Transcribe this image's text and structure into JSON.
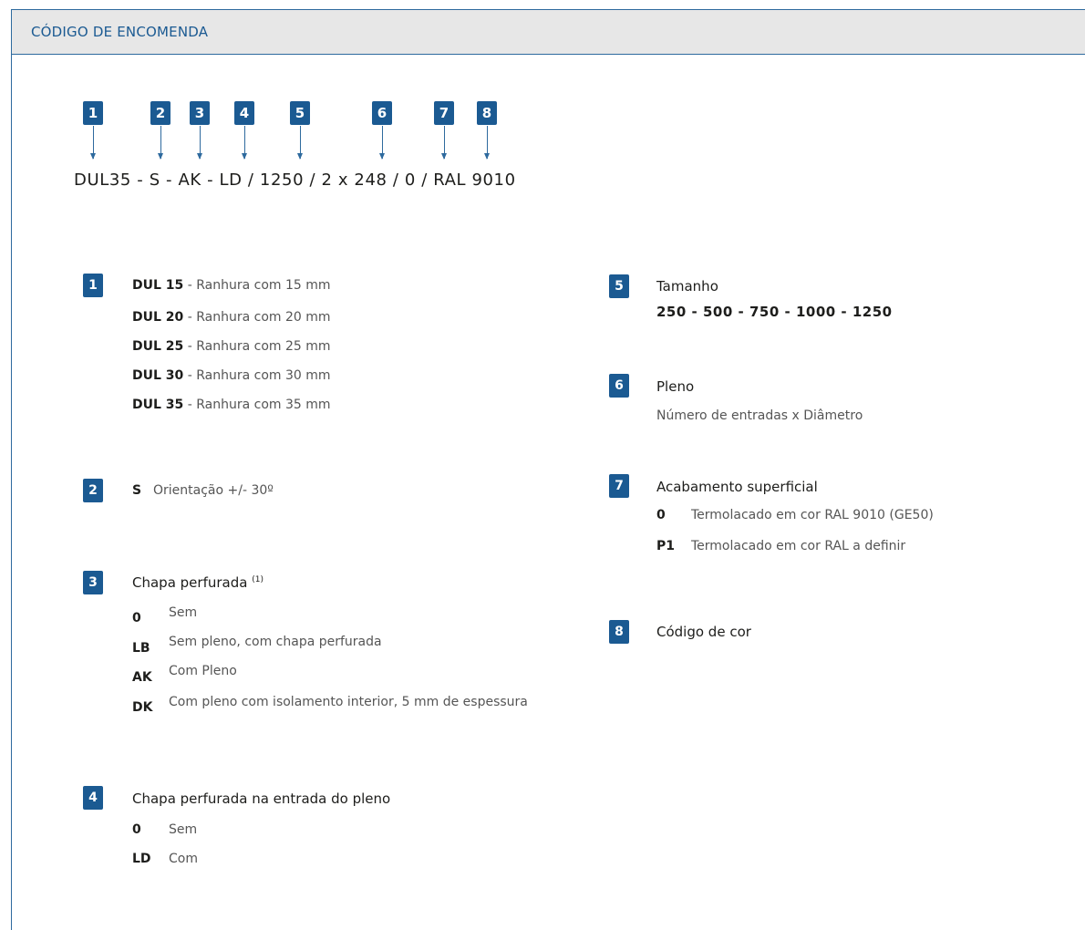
{
  "header": {
    "title": "CÓDIGO DE ENCOMENDA"
  },
  "code": {
    "badges": [
      "1",
      "2",
      "3",
      "4",
      "5",
      "6",
      "7",
      "8"
    ],
    "text": "DUL35 - S - AK - LD / 1250 / 2 x 248 / 0 / RAL 9010"
  },
  "sections": {
    "s1": {
      "num": "1",
      "items": [
        {
          "code": "DUL 15",
          "desc": " - Ranhura com 15 mm"
        },
        {
          "code": "DUL 20",
          "desc": " - Ranhura com 20 mm"
        },
        {
          "code": "DUL 25",
          "desc": " - Ranhura com 25 mm"
        },
        {
          "code": "DUL 30",
          "desc": " - Ranhura com 30 mm"
        },
        {
          "code": "DUL 35",
          "desc": " - Ranhura com 35 mm"
        }
      ]
    },
    "s2": {
      "num": "2",
      "code": "S",
      "desc": "Orientação +/- 30º"
    },
    "s3": {
      "num": "3",
      "title": "Chapa perfurada",
      "note": "(1)",
      "items": [
        {
          "code": "0",
          "desc": "Sem"
        },
        {
          "code": "LB",
          "desc": "Sem pleno, com chapa perfurada"
        },
        {
          "code": "AK",
          "desc": "Com Pleno"
        },
        {
          "code": "DK",
          "desc": "Com pleno com isolamento interior, 5 mm de espessura"
        }
      ]
    },
    "s4": {
      "num": "4",
      "title": "Chapa perfurada na entrada do pleno",
      "items": [
        {
          "code": "0",
          "desc": "Sem"
        },
        {
          "code": "LD",
          "desc": "Com"
        }
      ]
    },
    "s5": {
      "num": "5",
      "title": "Tamanho",
      "values": "250 - 500 - 750 - 1000 - 1250"
    },
    "s6": {
      "num": "6",
      "title": "Pleno",
      "desc": "Número de entradas x Diâmetro"
    },
    "s7": {
      "num": "7",
      "title": "Acabamento superficial",
      "items": [
        {
          "code": "0",
          "desc": "Termolacado em cor RAL 9010 (GE50)"
        },
        {
          "code": "P1",
          "desc": "Termolacado em cor RAL a definir"
        }
      ]
    },
    "s8": {
      "num": "8",
      "title": "Código de cor"
    }
  },
  "colors": {
    "accent": "#1b5a92",
    "header_bg": "#e7e7e7"
  }
}
